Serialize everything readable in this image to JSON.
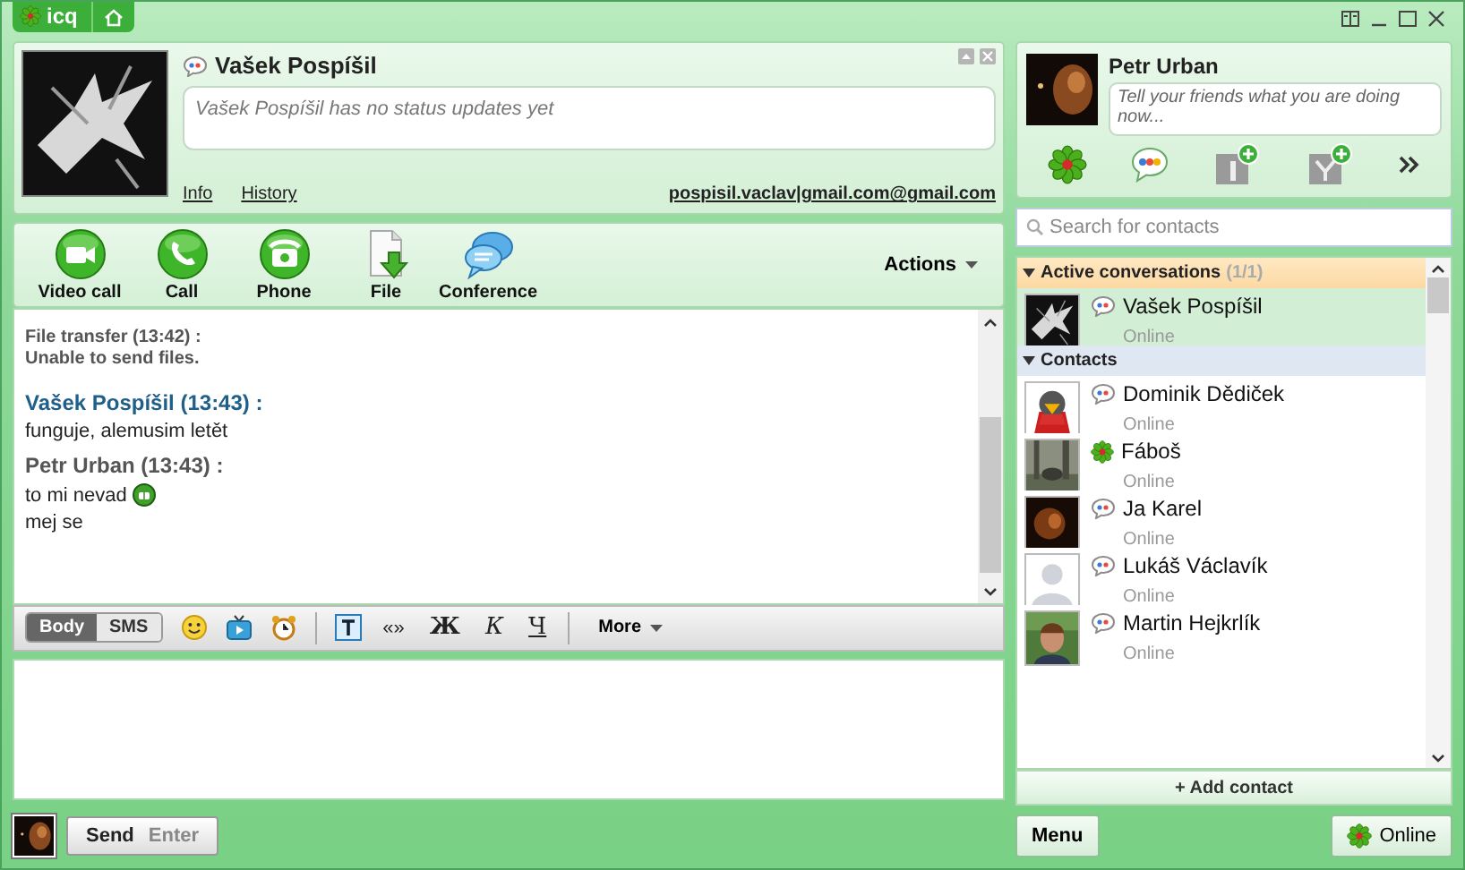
{
  "app_tab": {
    "label": "icq"
  },
  "contact": {
    "name": "Vašek Pospíšil",
    "status": "Vašek Pospíšil has no status updates yet",
    "links": [
      "Info",
      "History"
    ],
    "email": "pospisil.vaclav|gmail.com@gmail.com"
  },
  "actions": [
    {
      "label": "Video call",
      "kind": "video"
    },
    {
      "label": "Call",
      "kind": "call"
    },
    {
      "label": "Phone",
      "kind": "phone"
    },
    {
      "label": "File",
      "kind": "file"
    },
    {
      "label": "Conference",
      "kind": "conference"
    }
  ],
  "actions_menu": "Actions",
  "messages": [
    {
      "kind": "system",
      "header": "File transfer (13:42) :",
      "lines": [
        {
          "text": "Unable to send files.",
          "emoticon": false
        }
      ]
    },
    {
      "kind": "incoming",
      "header": "Vašek Pospíšil (13:43) :",
      "lines": [
        {
          "text": "funguje, alemusim letět",
          "emoticon": false
        }
      ]
    },
    {
      "kind": "outgoing",
      "header": "Petr Urban (13:43) :",
      "lines": [
        {
          "text": "to mi nevad",
          "emoticon": true
        },
        {
          "text": "mej se",
          "emoticon": false
        }
      ]
    }
  ],
  "modes": [
    {
      "label": "Body",
      "selected": true
    },
    {
      "label": "SMS",
      "selected": false
    }
  ],
  "format_buttons": [
    {
      "label": "«»",
      "kind": "quote"
    },
    {
      "label": "Ж",
      "kind": "bold"
    },
    {
      "label": "К",
      "kind": "italic"
    },
    {
      "label": "Ч",
      "kind": "underline"
    }
  ],
  "more_menu": "More",
  "send": {
    "label": "Send",
    "hint": "Enter"
  },
  "profile": {
    "name": "Petr Urban",
    "placeholder": "Tell your friends what you are doing now..."
  },
  "search": {
    "placeholder": "Search for contacts"
  },
  "groups": [
    {
      "title": "Active conversations",
      "count": "(1/1)",
      "kind": "active",
      "expanded": true,
      "contacts": [
        {
          "name": "Vašek Pospíšil",
          "status": "Online",
          "kind": "gtalk",
          "selected": true
        }
      ]
    },
    {
      "title": "Contacts",
      "kind": "contacts",
      "expanded": true,
      "contacts": [
        {
          "name": "Dominik Dědiček",
          "status": "Online",
          "kind": "gtalk",
          "selected": false
        },
        {
          "name": "Fáboš",
          "status": "Online",
          "kind": "icq",
          "selected": false
        },
        {
          "name": "Ja Karel",
          "status": "Online",
          "kind": "gtalk",
          "selected": false
        },
        {
          "name": "Lukáš Václavík",
          "status": "Online",
          "kind": "gtalk",
          "selected": false
        },
        {
          "name": "Martin Hejkrlík",
          "status": "Online",
          "kind": "gtalk",
          "selected": false
        }
      ]
    }
  ],
  "add_contact": "+ Add contact",
  "menu_button": "Menu",
  "status_button": "Online"
}
